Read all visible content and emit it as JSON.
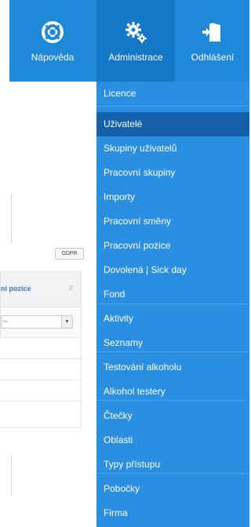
{
  "topnav": {
    "help_label": "Nápověda",
    "admin_label": "Administrace",
    "logout_label": "Odhlášení",
    "color": "#1e88d9",
    "active_color": "#1577c8"
  },
  "admin_menu": {
    "background": "#2a8fe0",
    "active_background": "#1560a8",
    "items": [
      {
        "label": "Licence"
      },
      {
        "label": "Uživatelé",
        "active": true
      },
      {
        "label": "Skupiny uživatelů"
      },
      {
        "label": "Pracovní skupiny"
      },
      {
        "label": "Importy"
      },
      {
        "label": "Pracovní směny"
      },
      {
        "label": "Pracovní pozice"
      },
      {
        "label": "Dovolená | Sick day"
      },
      {
        "label": "Fond"
      },
      {
        "label": "Aktivity"
      },
      {
        "label": "Seznamy"
      },
      {
        "label": "Testování alkoholu"
      },
      {
        "label": "Alkohol testery"
      },
      {
        "label": "Čtečky"
      },
      {
        "label": "Oblasti"
      },
      {
        "label": "Typy přístupu"
      },
      {
        "label": "Pobočky"
      },
      {
        "label": "Firma"
      }
    ]
  },
  "background_page": {
    "gdpr_button": "GDPR",
    "table": {
      "column_header": "ní pozice",
      "filter_value": "--"
    }
  }
}
